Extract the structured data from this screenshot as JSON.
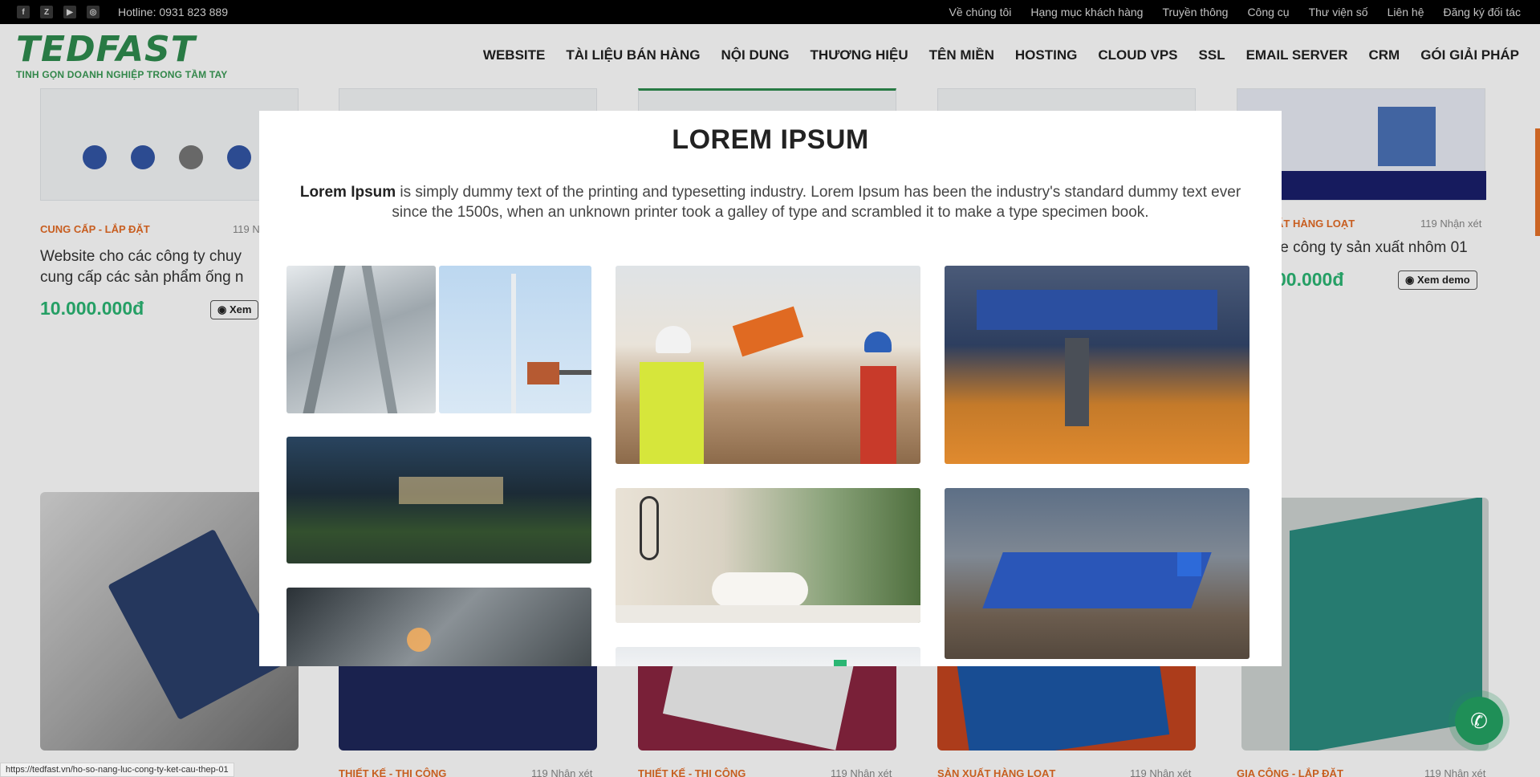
{
  "topbar": {
    "social": [
      {
        "name": "facebook-icon",
        "glyph": "f"
      },
      {
        "name": "zalo-icon",
        "glyph": "Z"
      },
      {
        "name": "youtube-icon",
        "glyph": "▶"
      },
      {
        "name": "instagram-icon",
        "glyph": "◎"
      }
    ],
    "hotline": "Hotline: 0931 823 889",
    "links": [
      "Về chúng tôi",
      "Hạng mục khách hàng",
      "Truyền thông",
      "Công cụ",
      "Thư viện số",
      "Liên hệ",
      "Đăng ký đối tác"
    ]
  },
  "logo": {
    "text": "TEDFAST",
    "tagline": "TINH GỌN DOANH NGHIỆP TRONG TẦM TAY"
  },
  "nav": [
    "WEBSITE",
    "TÀI LIỆU BÁN HÀNG",
    "NỘI DUNG",
    "THƯƠNG HIỆU",
    "TÊN MIỀN",
    "HOSTING",
    "CLOUD VPS",
    "SSL",
    "EMAIL SERVER",
    "CRM",
    "GÓI GIẢI PHÁP"
  ],
  "cards_top": [
    {
      "category": "CUNG CẤP - LẮP ĐẶT",
      "reviews": "119 N",
      "title_line1": "Website cho các công ty chuy",
      "title_line2": "cung cấp các sản phẩm ống n",
      "price": "10.000.000đ",
      "demo": "Xem"
    },
    {
      "category": "ẤT HÀNG LOẠT",
      "reviews": "119 Nhận xét",
      "title_line1": "te công ty sản xuất nhôm 01",
      "price": "00.000đ",
      "demo": "Xem demo"
    }
  ],
  "cards_bottom": [
    {
      "category": "THIẾT KẾ - THI CÔNG",
      "reviews": "119 Nhận xét"
    },
    {
      "category": "THIẾT KẾ - THI CÔNG",
      "reviews": "119 Nhận xét"
    },
    {
      "category": "SẢN XUẤT HÀNG LOẠT",
      "reviews": "119 Nhận xét"
    },
    {
      "category": "GIA CÔNG - LẮP ĐẶT",
      "reviews": "119 Nhận xét"
    }
  ],
  "modal": {
    "title": "LOREM IPSUM",
    "desc_bold": "Lorem Ipsum",
    "desc_rest": " is simply dummy text of the printing and typesetting industry. Lorem Ipsum has been the industry's standard dummy text ever since the 1500s, when an unknown printer took a galley of type and scrambled it to make a type specimen book."
  },
  "status_url": "https://tedfast.vn/ho-so-nang-luc-cong-ty-ket-cau-thep-01",
  "colors": {
    "brand_green": "#2e8b4e",
    "price_green": "#2bb673",
    "category_orange": "#e46b25",
    "fab_green": "#1f8f57"
  }
}
